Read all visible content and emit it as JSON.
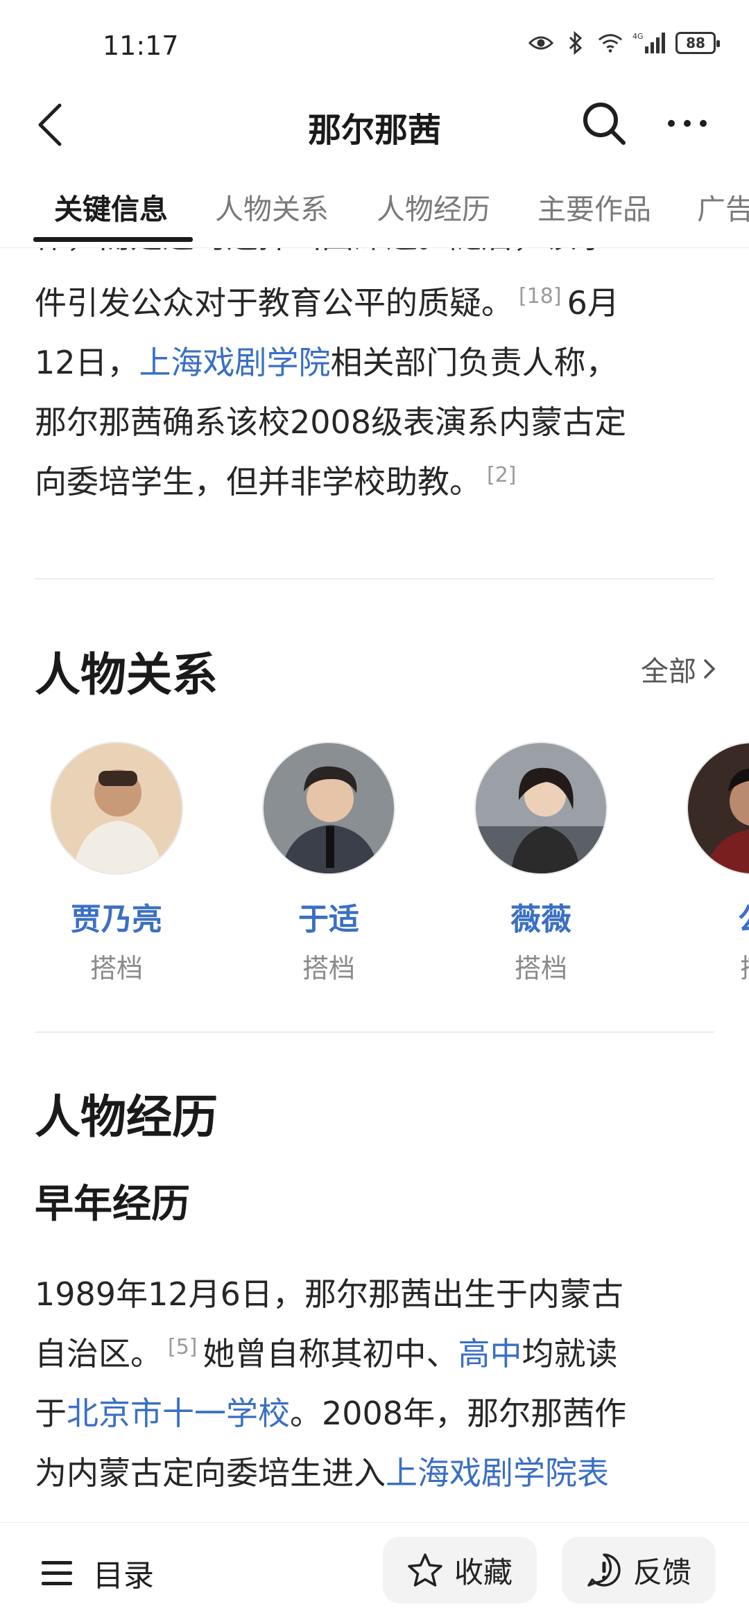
{
  "status_bar": {
    "time": "11:17",
    "battery": "88",
    "network": "4G"
  },
  "nav": {
    "title": "那尔那茜"
  },
  "tabs": [
    {
      "label": "关键信息",
      "active": true
    },
    {
      "label": "人物关系",
      "active": false
    },
    {
      "label": "人物经历",
      "active": false
    },
    {
      "label": "主要作品",
      "active": false
    },
    {
      "label": "广告",
      "active": false
    }
  ],
  "article_top": {
    "cut_line": "作，而是违约选择出国深造。随后，该事",
    "line1": "件引发公众对于教育公平的质疑。",
    "ref1": "[18]",
    "line1_end": "6月",
    "line2_start": "12日，",
    "link1": "上海戏剧学院",
    "line2_end": "相关部门负责人称，",
    "line3": "那尔那茜确系该校2008级表演系内蒙古定",
    "line4": "向委培学生，但并非学校助教。",
    "ref2": "[2]"
  },
  "relations": {
    "title": "人物关系",
    "see_all": "全部",
    "people": [
      {
        "name": "贾乃亮",
        "role": "搭档"
      },
      {
        "name": "于适",
        "role": "搭档"
      },
      {
        "name": "薇薇",
        "role": "搭档"
      },
      {
        "name": "公",
        "role": "搭"
      }
    ]
  },
  "experience": {
    "title": "人物经历",
    "subtitle": "早年经历",
    "l1": "1989年12月6日，那尔那茜出生于内蒙古",
    "l2_start": "自治区。",
    "ref": "[5]",
    "l2_end": "她曾自称其初中、",
    "link_highschool": "高中",
    "l2_tail": "均就读",
    "l3_start": "于",
    "link_school": "北京市十一学校",
    "l3_end": "。2008年，那尔那茜作",
    "l4_start": "为内蒙古定向委培生进入",
    "link_academy": "上海戏剧学院表"
  },
  "bottom_bar": {
    "toc": "目录",
    "favorite": "收藏",
    "feedback": "反馈"
  },
  "colors": {
    "link": "#3a6fc4",
    "text": "#262626",
    "muted": "#8a8a8a"
  }
}
